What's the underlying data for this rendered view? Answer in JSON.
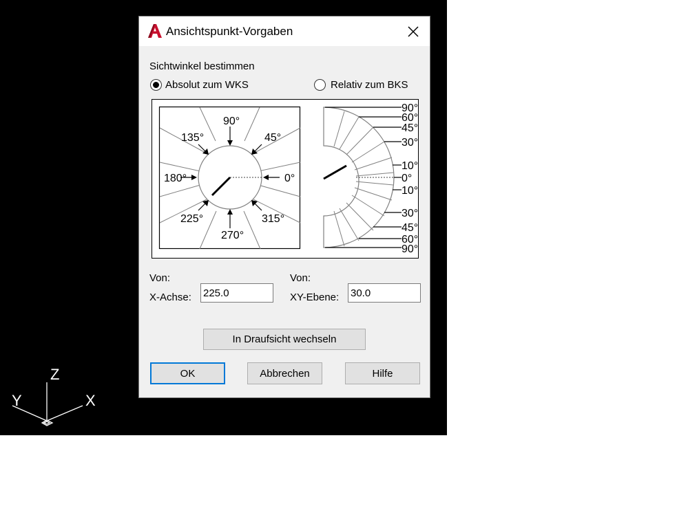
{
  "dialog": {
    "title": "Ansichtspunkt-Vorgaben",
    "close_glyph": "✕",
    "section_label": "Sichtwinkel bestimmen",
    "radio_absolute": {
      "label": "Absolut zum WKS",
      "checked": true
    },
    "radio_relative": {
      "label": "Relativ zum BKS",
      "checked": false
    },
    "from_label_left": "Von:",
    "x_axis_label": "X-Achse:",
    "x_axis_value": "225.0",
    "from_label_right": "Von:",
    "xy_plane_label": "XY-Ebene:",
    "xy_plane_value": "30.0",
    "plan_view_button": "In Draufsicht wechseln",
    "ok_button": "OK",
    "cancel_button": "Abbrechen",
    "help_button": "Hilfe"
  },
  "diagram": {
    "compass_labels": {
      "a0": "0°",
      "a45": "45°",
      "a90": "90°",
      "a135": "135°",
      "a180": "180°",
      "a225": "225°",
      "a270": "270°",
      "a315": "315°"
    },
    "elevation_labels": {
      "t90": "90°",
      "t60": "60°",
      "t45": "45°",
      "t30": "30°",
      "t10": "10°",
      "z0": "0°",
      "b10": "10°",
      "b30": "30°",
      "b45": "45°",
      "b60": "60°",
      "b90": "90°"
    }
  },
  "ucs_icon": {
    "x": "X",
    "y": "Y",
    "z": "Z"
  },
  "colors": {
    "dialog_bg": "#f0f0f0",
    "default_button_border": "#0078d7",
    "app_icon_red": "#c8102e"
  }
}
